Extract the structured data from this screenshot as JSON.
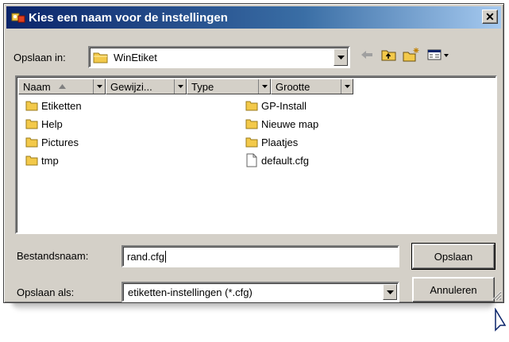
{
  "dialog": {
    "title": "Kies een naam voor de instellingen",
    "close_glyph": "✕"
  },
  "location": {
    "label": "Opslaan in:",
    "value": "WinEtiket"
  },
  "toolbar": {
    "icons": [
      "back-arrow-icon",
      "up-folder-icon",
      "new-folder-icon",
      "view-menu-icon"
    ]
  },
  "list": {
    "columns": [
      "Naam",
      "Gewijzi...",
      "Type",
      "Grootte"
    ],
    "items_left": [
      {
        "name": "Etiketten",
        "icon": "folder-icon"
      },
      {
        "name": "Help",
        "icon": "folder-icon"
      },
      {
        "name": "Pictures",
        "icon": "folder-icon"
      },
      {
        "name": "tmp",
        "icon": "folder-icon"
      }
    ],
    "items_right": [
      {
        "name": "GP-Install",
        "icon": "folder-icon"
      },
      {
        "name": "Nieuwe map",
        "icon": "folder-icon"
      },
      {
        "name": "Plaatjes",
        "icon": "folder-icon"
      },
      {
        "name": "default.cfg",
        "icon": "file-icon"
      }
    ]
  },
  "filename": {
    "label": "Bestandsnaam:",
    "value": "rand.cfg"
  },
  "filetype": {
    "label": "Opslaan als:",
    "value": "etiketten-instellingen (*.cfg)"
  },
  "buttons": {
    "save": "Opslaan",
    "cancel": "Annuleren"
  },
  "colors": {
    "title_bar_start": "#0a246a",
    "title_bar_end": "#a6caf0",
    "dialog_face": "#d4d0c8",
    "folder_yellow": "#f3c94a"
  }
}
